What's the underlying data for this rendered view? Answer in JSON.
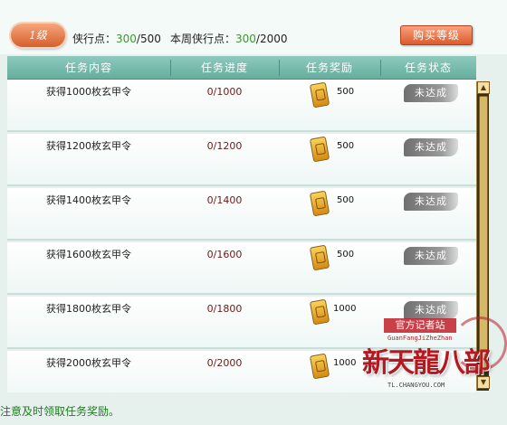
{
  "header": {
    "level_label": "1级",
    "points_label": "侠行点：",
    "points_current": "300",
    "points_max": "/500",
    "weekly_label": "本周侠行点：",
    "weekly_current": "300",
    "weekly_max": "/2000",
    "buy_button": "购买等级"
  },
  "table": {
    "columns": [
      "任务内容",
      "任务进度",
      "任务奖励",
      "任务状态"
    ],
    "rows": [
      {
        "content": "获得1000枚玄甲令",
        "progress": "0/1000",
        "reward": "500",
        "reward_icon": "token-icon",
        "status": "未达成"
      },
      {
        "content": "获得1200枚玄甲令",
        "progress": "0/1200",
        "reward": "500",
        "reward_icon": "token-icon",
        "status": "未达成"
      },
      {
        "content": "获得1400枚玄甲令",
        "progress": "0/1400",
        "reward": "500",
        "reward_icon": "token-icon",
        "status": "未达成"
      },
      {
        "content": "获得1600枚玄甲令",
        "progress": "0/1600",
        "reward": "500",
        "reward_icon": "token-icon",
        "status": "未达成"
      },
      {
        "content": "获得1800枚玄甲令",
        "progress": "0/1800",
        "reward": "1000",
        "reward_icon": "token-icon",
        "status": "未达成"
      },
      {
        "content": "获得2000枚玄甲令",
        "progress": "0/2000",
        "reward": "1000",
        "reward_icon": "token-icon",
        "status": ""
      }
    ]
  },
  "scrollbar": {
    "up_icon": "up-arrow-icon",
    "down_icon": "down-arrow-icon"
  },
  "watermark": {
    "site": "官方记者站",
    "sub": "GuanFangJiZheZhan",
    "logo": "新天龍八部",
    "domain": "TL.CHANGYOU.COM"
  },
  "footer": {
    "hint": "注意及时领取任务奖励。"
  },
  "colors": {
    "accent": "#d55f2c",
    "header_bg": "#66ad9d",
    "value_green": "#3a9a2a",
    "hint_green": "#1f7a1f"
  }
}
